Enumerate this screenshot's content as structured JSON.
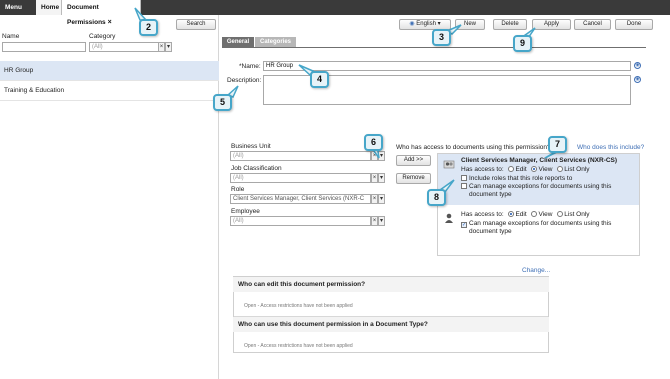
{
  "topbar": {
    "menu": "Menu",
    "home": "Home",
    "active_tab": "Document Permissions",
    "close": "×"
  },
  "left": {
    "search_button": "Search",
    "name_label": "Name",
    "category_label": "Category",
    "category_value": "(All)",
    "items": [
      "HR Group",
      "Training & Education"
    ]
  },
  "toolbar": {
    "language": "English",
    "new": "New",
    "delete": "Delete",
    "apply": "Apply",
    "cancel": "Cancel",
    "done": "Done"
  },
  "tabs": {
    "general": "General",
    "categories": "Categories"
  },
  "form": {
    "name_label": "*Name:",
    "name_value": "HR Group",
    "description_label": "Description:",
    "description_value": ""
  },
  "criteria": {
    "business_unit_label": "Business Unit",
    "business_unit_value": "(All)",
    "job_label": "Job Classification",
    "job_value": "(All)",
    "role_label": "Role",
    "role_value": "Client Services Manager, Client Services (NXR-C",
    "employee_label": "Employee",
    "employee_value": "(All)",
    "add_button": "Add >>",
    "remove_button": "Remove"
  },
  "access": {
    "question": "Who has access to documents using this permission?",
    "include_link": "Who does this include?",
    "entry1": {
      "title": "Client Services Manager, Client Services (NXR-CS)",
      "has_access": "Has access to:",
      "opt_edit": "Edit",
      "opt_view": "View",
      "opt_list": "List Only",
      "include_roles": "Include roles that this role reports to",
      "manage1": "Can manage exceptions for documents using this",
      "manage2": "document type"
    },
    "entry2": {
      "has_access": "Has access to:",
      "opt_edit": "Edit",
      "opt_view": "View",
      "opt_list": "List Only",
      "manage1": "Can manage exceptions for documents using this",
      "manage2": "document type"
    },
    "change_link": "Change..."
  },
  "sections": {
    "edit_title": "Who can edit this document permission?",
    "edit_status": "Open - Access restrictions have not been applied",
    "use_title": "Who can use this document permission in a Document Type?",
    "use_status": "Open - Access restrictions have not been applied"
  },
  "callouts": [
    "2",
    "3",
    "4",
    "5",
    "6",
    "7",
    "8",
    "9"
  ]
}
